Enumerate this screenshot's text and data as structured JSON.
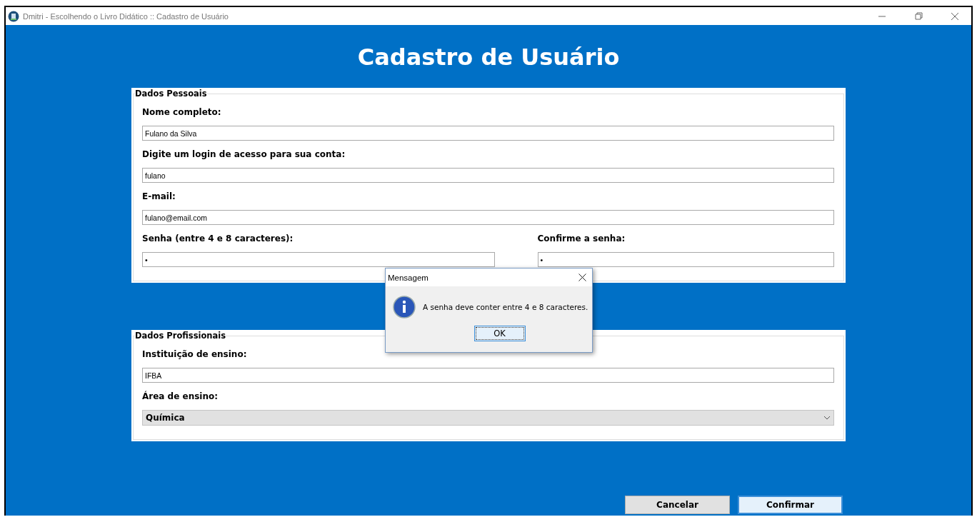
{
  "window": {
    "title": "Dmitri - Escolhendo o Livro Didático :: Cadastro de Usuário"
  },
  "heading": "Cadastro de Usuário",
  "sections": [
    {
      "legend": "Dados Pessoais",
      "rows": [
        [
          {
            "kind": "text",
            "label": "Nome completo:",
            "value": "Fulano da Silva"
          }
        ],
        [
          {
            "kind": "text",
            "label": "Digite um login de acesso para sua conta:",
            "value": "fulano"
          }
        ],
        [
          {
            "kind": "text",
            "label": "E-mail:",
            "value": "fulano@email.com"
          }
        ],
        [
          {
            "kind": "password",
            "label": "Senha (entre 4 e 8 caracteres):",
            "value": "•"
          },
          {
            "kind": "password",
            "label": "Confirme a senha:",
            "value": "•"
          }
        ]
      ]
    },
    {
      "legend": "Dados Profissionais",
      "rows": [
        [
          {
            "kind": "text",
            "label": "Instituição de ensino:",
            "value": "IFBA"
          }
        ],
        [
          {
            "kind": "select",
            "label": "Área de ensino:",
            "value": "Química"
          }
        ]
      ]
    }
  ],
  "buttons": [
    {
      "label": "Cancelar",
      "focused": false
    },
    {
      "label": "Confirmar",
      "focused": true
    }
  ],
  "dialog": {
    "title": "Mensagem",
    "message": "A senha deve conter entre 4 e 8 caracteres.",
    "button": "OK"
  }
}
